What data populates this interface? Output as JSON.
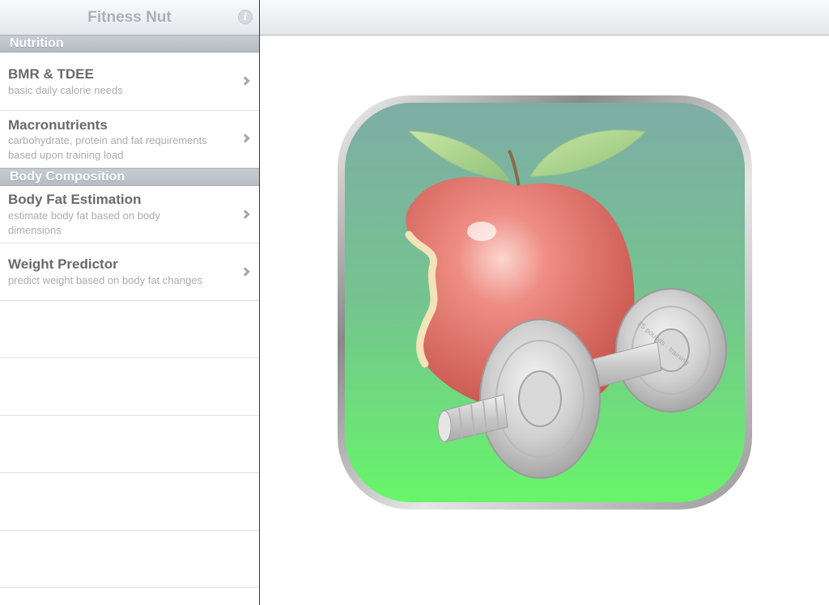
{
  "master": {
    "title": "Fitness Nut",
    "info_icon": "info-icon",
    "info_glyph": "i",
    "sections": [
      {
        "header": "Nutrition",
        "rows": [
          {
            "title": "BMR & TDEE",
            "subtitle": "basic daily calorie needs"
          },
          {
            "title": "Macronutrients",
            "subtitle": "carbohydrate, protein and fat requirements based upon training load"
          }
        ]
      },
      {
        "header": "Body Composition",
        "rows": [
          {
            "title": "Body Fat Estimation",
            "subtitle": "estimate body fat based on body dimensions"
          },
          {
            "title": "Weight Predictor",
            "subtitle": "predict weight based on body fat changes"
          }
        ]
      }
    ],
    "disclosure_icon": "chevron-right-icon"
  },
  "detail": {
    "image": "app-icon-apple-dumbbell",
    "dumbbell_engraving": "25 pounds · training"
  },
  "colors": {
    "nav_title": "#a9afb7",
    "section_header": "#b6bcc4",
    "cell_title": "#6a6a6a",
    "cell_subtitle": "#acacac",
    "icon_bg_top": "#7fb0a8",
    "icon_bg_bottom": "#6cf56c",
    "apple": "#e8706a"
  }
}
